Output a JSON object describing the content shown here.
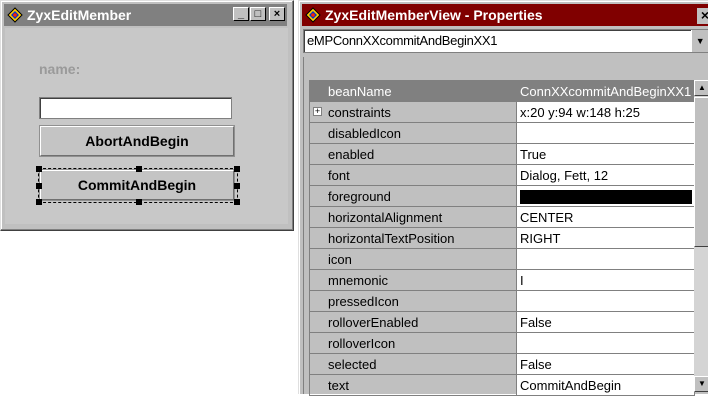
{
  "left_window": {
    "title": "ZyxEditMember",
    "minimize_glyph": "_",
    "maximize_glyph": "□",
    "close_glyph": "×",
    "form": {
      "name_label": "name:",
      "name_value": "",
      "abort_button": "AbortAndBegin",
      "commit_button": "CommitAndBegin"
    }
  },
  "right_window": {
    "title": "ZyxEditMemberView - Properties",
    "close_glyph": "×",
    "bean_selector": "eMPConnXXcommitAndBeginXX1",
    "properties": [
      {
        "name": "beanName",
        "value": "ConnXXcommitAndBeginXX1",
        "selected": true
      },
      {
        "name": "constraints",
        "value": "x:20 y:94 w:148 h:25",
        "expandable": true
      },
      {
        "name": "disabledIcon",
        "value": ""
      },
      {
        "name": "enabled",
        "value": "True"
      },
      {
        "name": "font",
        "value": "Dialog, Fett, 12"
      },
      {
        "name": "foreground",
        "value": "",
        "color": "#000000"
      },
      {
        "name": "horizontalAlignment",
        "value": "CENTER"
      },
      {
        "name": "horizontalTextPosition",
        "value": "RIGHT"
      },
      {
        "name": "icon",
        "value": ""
      },
      {
        "name": "mnemonic",
        "value": "I"
      },
      {
        "name": "pressedIcon",
        "value": ""
      },
      {
        "name": "rolloverEnabled",
        "value": "False"
      },
      {
        "name": "rolloverIcon",
        "value": ""
      },
      {
        "name": "selected",
        "value": "False"
      },
      {
        "name": "text",
        "value": "CommitAndBegin"
      }
    ]
  },
  "colors": {
    "active_title": "#800000",
    "inactive_title": "#808080",
    "selected_row": "#808080"
  }
}
